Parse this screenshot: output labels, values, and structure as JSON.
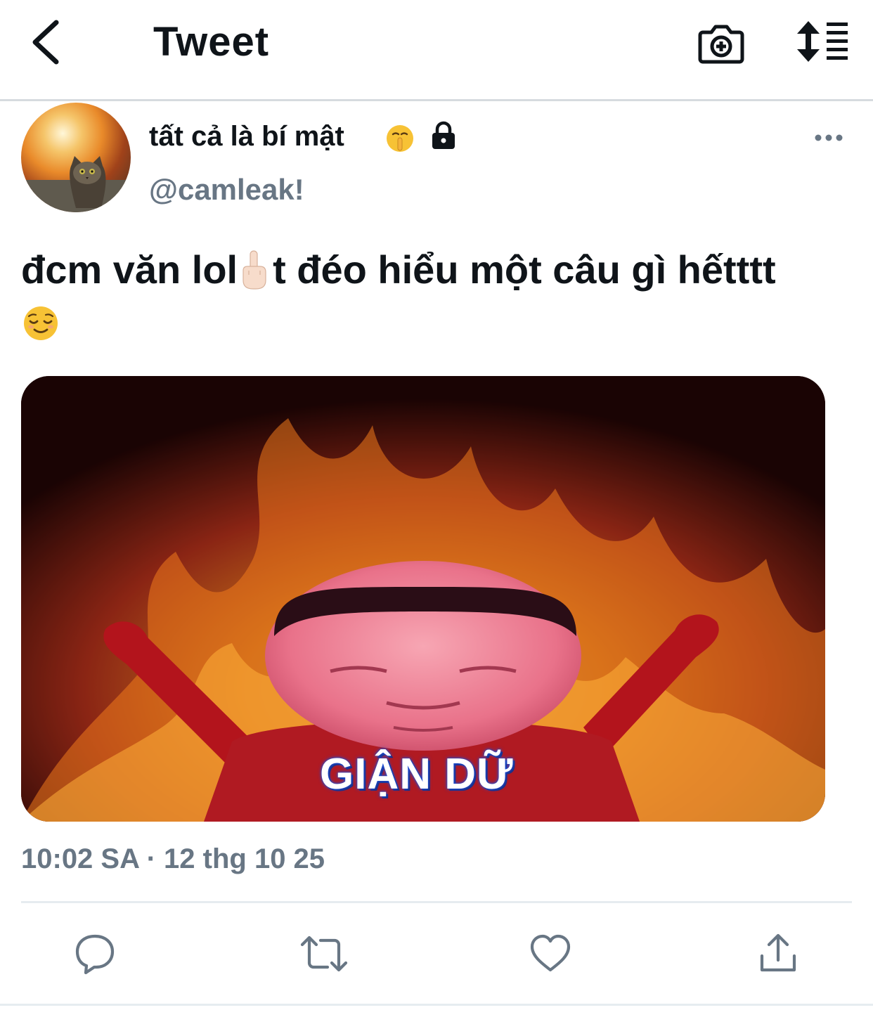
{
  "header": {
    "title": "Tweet",
    "back_icon": "chevron-left-icon",
    "camera_icon": "camera-plus-icon",
    "sort_icon": "sort-list-icon"
  },
  "tweet": {
    "display_name": "tất cả là bí mật",
    "display_name_emoji": "shushing-face-emoji",
    "protected_icon": "lock-icon",
    "handle": "@camleak!",
    "text_line1_part1": "đcm văn lol",
    "text_line1_part2": "t đéo hiểu một câu gì hếtttt",
    "text_emojis": [
      "middle-finger-emoji",
      "relieved-face-emoji"
    ],
    "media_caption": "GIẬN DỮ",
    "timestamp": "10:02 SA · 12 thg 10 25"
  },
  "actions": {
    "reply_icon": "reply-icon",
    "retweet_icon": "retweet-icon",
    "like_icon": "heart-icon",
    "share_icon": "share-icon"
  },
  "colors": {
    "text_primary": "#0f1419",
    "text_secondary": "#687684",
    "divider": "#e6ecf0"
  }
}
